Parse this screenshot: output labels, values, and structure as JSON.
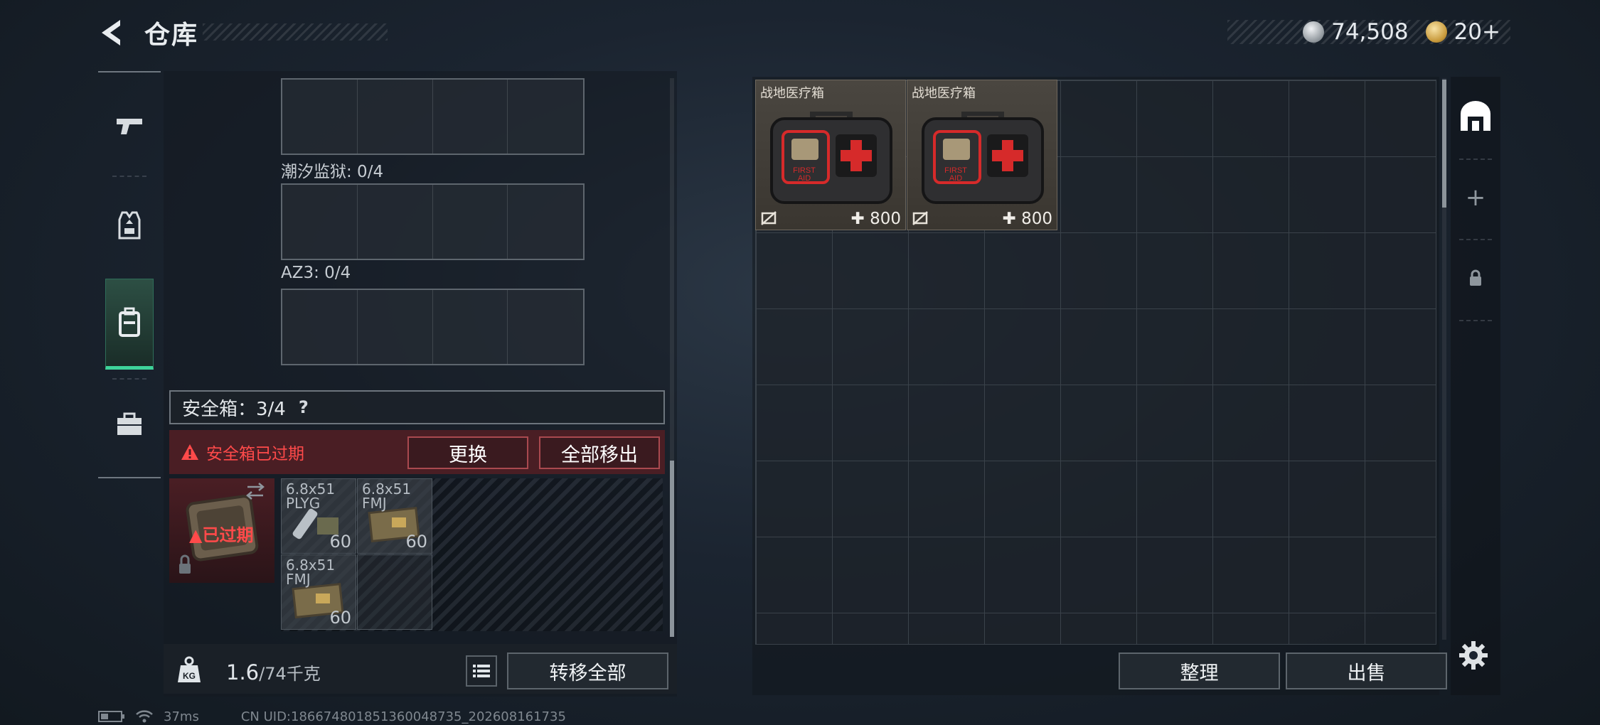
{
  "header": {
    "title": "仓库",
    "currency": [
      {
        "icon": "silver-coin-icon",
        "value": "74,508"
      },
      {
        "icon": "gold-coin-icon",
        "value": "20+"
      }
    ]
  },
  "left_tabs": [
    {
      "icon": "pistol-icon",
      "active": false
    },
    {
      "icon": "vest-icon",
      "active": false
    },
    {
      "icon": "backpack-icon",
      "active": true
    },
    {
      "icon": "briefcase-icon",
      "active": false
    }
  ],
  "pockets": [
    {
      "label": ""
    },
    {
      "label": "潮汐监狱: 0/4"
    },
    {
      "label": "AZ3: 0/4"
    }
  ],
  "safe_box": {
    "title": "安全箱：3/4",
    "help": "?",
    "expired_text": "安全箱已过期",
    "replace_label": "更换",
    "remove_all_label": "全部移出",
    "case_expired_label": "已过期",
    "ammo": [
      {
        "name": "6.8x51 PLYG",
        "count": "60"
      },
      {
        "name": "6.8x51 FMJ",
        "count": "60"
      },
      {
        "name": "6.8x51 FMJ",
        "count": "60"
      }
    ]
  },
  "bottom_bar": {
    "weight_current": "1.6",
    "weight_max": "/74千克",
    "transfer_all_label": "转移全部"
  },
  "stash": {
    "items": [
      {
        "name": "战地医疗箱",
        "value": "800"
      },
      {
        "name": "战地医疗箱",
        "value": "800"
      }
    ],
    "sort_label": "整理",
    "sell_label": "出售"
  },
  "right_tabs": [
    {
      "icon": "stash-icon"
    },
    {
      "icon": "plus-icon",
      "text": "+"
    },
    {
      "icon": "lock-icon"
    }
  ],
  "footer": {
    "ping": "37ms",
    "uid": "CN UID:18667480185136004873​5_202608161735"
  },
  "colors": {
    "accent_green": "#3ed39a",
    "warning_red": "#ff4a4a",
    "expired_bg": "#4a1e24"
  }
}
